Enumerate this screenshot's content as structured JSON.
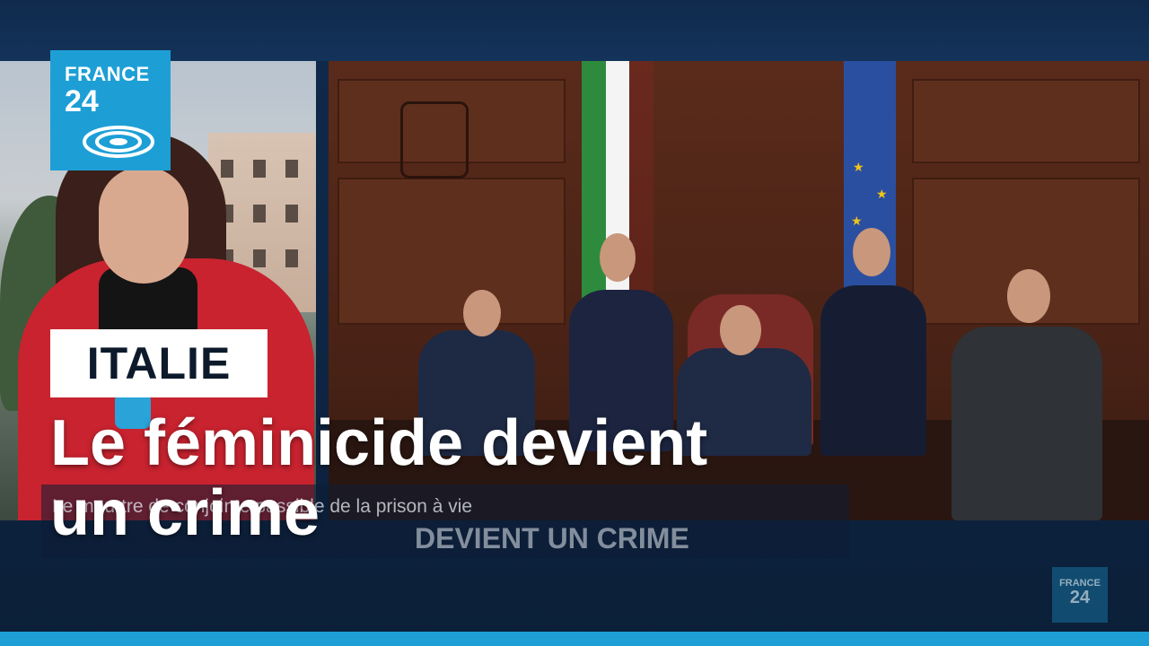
{
  "brand": {
    "logo_line1": "FRANCE",
    "logo_line2": "24",
    "watermark_line1": "FRANCE",
    "watermark_line2": "24",
    "accent": "#1d9fd6"
  },
  "lower_third": {
    "tag": "ITALIE",
    "headline_line1": "Le féminicide devient",
    "headline_line2": "un crime",
    "ghost_caption_1": "Le meurtre de conjointe passible de la prison à vie",
    "ghost_caption_2": "DEVIENT UN CRIME"
  },
  "colors": {
    "flag_green": "#2e8b3e",
    "flag_white": "#f4f4f4",
    "flag_red": "#c8232f",
    "eu_blue": "#2b4fa0",
    "eu_star": "#f0c419"
  }
}
